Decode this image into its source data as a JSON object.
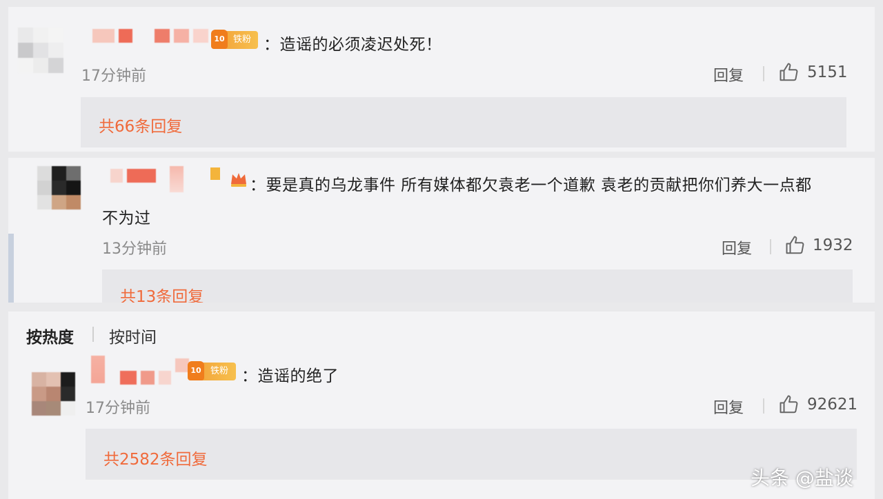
{
  "comments": [
    {
      "badge": "铁粉",
      "text": "：造谣的必须凌迟处死！",
      "time": "17分钟前",
      "reply_label": "回复",
      "likes": "5151",
      "reply_count": "共66条回复"
    },
    {
      "badge": "",
      "text_line1": "：要是真的乌龙事件 所有媒体都欠袁老一个道歉 袁老的贡献把你们养大一点都",
      "text_line2": "不为过",
      "time": "13分钟前",
      "reply_label": "回复",
      "likes": "1932",
      "reply_count": "共13条回复"
    },
    {
      "badge": "铁粉",
      "text": "：造谣的绝了",
      "time": "17分钟前",
      "reply_label": "回复",
      "likes": "92621",
      "reply_count": "共2582条回复"
    }
  ],
  "sort": {
    "by_hot": "按热度",
    "by_time": "按时间"
  },
  "watermark": "头条 @盐谈",
  "colors": {
    "accent_orange": "#f06a3b",
    "badge_orange": "#f2a33a",
    "background": "#f3f3f5"
  },
  "icons": {
    "like": "thumbs-up-icon",
    "badge": "fan-level-badge-icon"
  }
}
